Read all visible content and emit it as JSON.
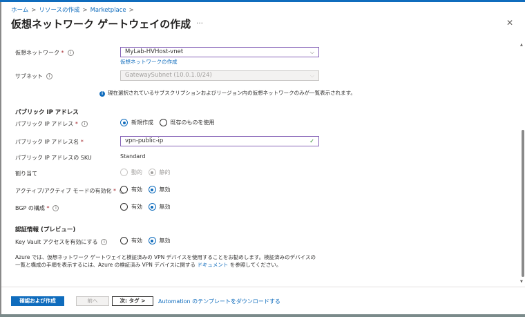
{
  "breadcrumb": [
    "ホーム",
    "リソースの作成",
    "Marketplace"
  ],
  "title": "仮想ネットワーク ゲートウェイの作成",
  "more": "…",
  "close": "✕",
  "fields": {
    "vnet": {
      "label": "仮想ネットワーク",
      "value": "MyLab-HVHost-vnet",
      "link": "仮想ネットワークの作成"
    },
    "subnet": {
      "label": "サブネット",
      "value": "GatewaySubnet (10.0.1.0/24)"
    },
    "info": "現在選択されているサブスクリプションおよびリージョン内の仮想ネットワークのみが一覧表示されます。"
  },
  "public_ip": {
    "section": "パブリック IP アドレス",
    "pip_label": "パブリック IP アドレス",
    "pip_options": [
      "新規作成",
      "既存のものを使用"
    ],
    "pip_selected": 0,
    "name_label": "パブリック IP アドレス名",
    "name_value": "vpn-public-ip",
    "sku_label": "パブリック IP アドレスの SKU",
    "sku_value": "Standard",
    "assign_label": "割り当て",
    "assign_options": [
      "動的",
      "静的"
    ],
    "assign_selected": 1,
    "active_label": "アクティブ/アクティブ モードの有効化",
    "active_options": [
      "有効",
      "無効"
    ],
    "active_selected": 1,
    "bgp_label": "BGP の構成",
    "bgp_options": [
      "有効",
      "無効"
    ],
    "bgp_selected": 1
  },
  "auth": {
    "section": "認証情報 (プレビュー)",
    "kv_label": "Key Vault アクセスを有効にする",
    "kv_options": [
      "有効",
      "無効"
    ],
    "kv_selected": 1
  },
  "note": {
    "text1": "Azure では、仮想ネットワーク ゲートウェイと検証済みの VPN デバイスを使用することをお勧めします。検証済みのデバイスの一覧と構成の手順を表示するには、Azure の検証済み VPN デバイスに関する ",
    "link": "ドキュメント",
    "text2": " を参照してください。"
  },
  "footer": {
    "review": "確認および作成",
    "prev": "前へ",
    "next": "次: タグ >",
    "download": "Automation のテンプレートをダウンロードする"
  },
  "scroll": {
    "position_percent": 75
  },
  "colors": {
    "accent": "#0f6cbd",
    "focus_border": "#8764b8",
    "required": "#a4262c"
  }
}
